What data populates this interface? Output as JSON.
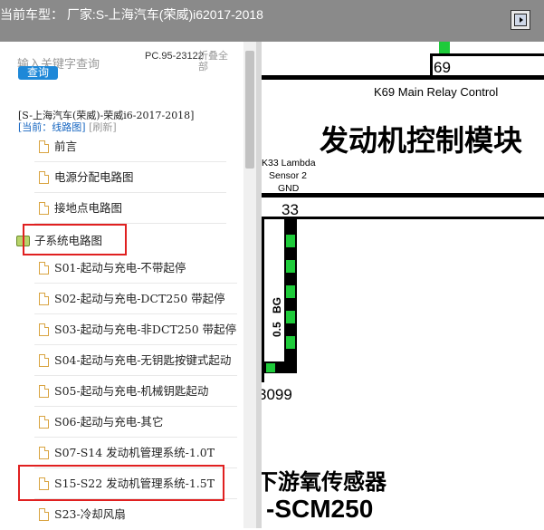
{
  "window": {
    "title": "当前车型：  厂家:S-上海汽车(荣威)i62017-2018"
  },
  "sidebar": {
    "search_placeholder": "输入关键字查询",
    "query_button": "查询",
    "pc_code": "PC.95-23122",
    "collapse_all": "折叠全部",
    "path_text": "[S-上海汽车(荣威)-荣威i6-2017-2018]",
    "current_label": "[当前：线路图]",
    "refresh_label": "[刷新]",
    "items_top": [
      {
        "label": "前言"
      },
      {
        "label": "电源分配电路图"
      },
      {
        "label": "接地点电路图"
      }
    ],
    "folder": {
      "label": "子系统电路图"
    },
    "items_sub": [
      {
        "label": "S01-起动与充电-不带起停"
      },
      {
        "label": "S02-起动与充电-DCT250 带起停"
      },
      {
        "label": "S03-起动与充电-非DCT250 带起停"
      },
      {
        "label": "S04-起动与充电-无钥匙按键式起动"
      },
      {
        "label": "S05-起动与充电-机械钥匙起动"
      },
      {
        "label": "S06-起动与充电-其它"
      },
      {
        "label": "S07-S14 发动机管理系统-1.0T"
      },
      {
        "label": "S15-S22 发动机管理系统-1.5T"
      },
      {
        "label": "S23-冷却风扇"
      }
    ]
  },
  "diagram": {
    "connector_69": "69",
    "k69_label": "K69 Main Relay Control",
    "heading": "发动机控制模块",
    "k33_label_1": "K33 Lambda",
    "k33_label_2": "Sensor 2",
    "k33_label_3": "GND",
    "pin_33": "33",
    "wire_color": "BG",
    "wire_size": "0.5",
    "splice": "3099",
    "bottom_title": "下游氧传感器",
    "bottom_model": "-SCM250"
  },
  "colors": {
    "title_bar": "#8a8a8a",
    "accent_blue": "#1e88d8",
    "highlight_red": "#e02020",
    "wire_green": "#1ecb3a"
  }
}
